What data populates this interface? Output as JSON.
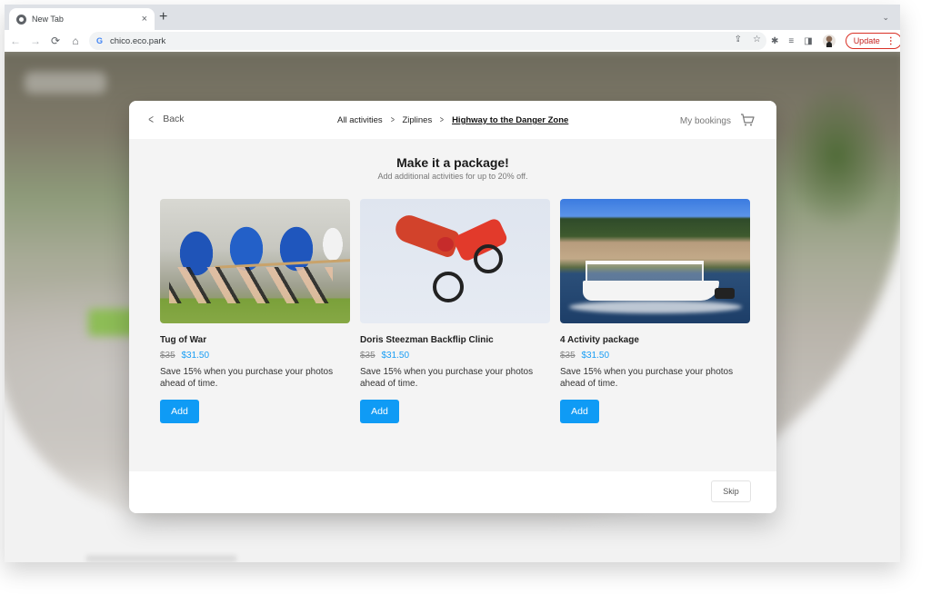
{
  "browser": {
    "tab_title": "New Tab",
    "tab_close": "×",
    "new_tab": "+",
    "tab_menu": "⌄",
    "url": "chico.eco.park",
    "update_label": "Update",
    "icons": {
      "back": "←",
      "forward": "→",
      "reload": "⟳",
      "home": "⌂",
      "share": "⇪",
      "bookmark": "☆",
      "extensions": "✱",
      "reading_list": "≡",
      "side_panel": "◨",
      "menu": "⋮"
    }
  },
  "modal": {
    "back_label": "Back",
    "breadcrumb": [
      {
        "label": "All activities"
      },
      {
        "label": "Ziplines"
      },
      {
        "label": "Highway to the Danger Zone"
      }
    ],
    "breadcrumb_separator": "›",
    "my_bookings": "My bookings",
    "title": "Make it a package!",
    "subtitle": "Add additional activities for up to 20% off.",
    "cards": [
      {
        "name": "Tug of War",
        "old_price": "$35",
        "new_price": "$31.50",
        "description": "Save 15% when you purchase your photos ahead of time.",
        "button": "Add",
        "image": "tug-of-war-photo"
      },
      {
        "name": "Doris Steezman Backflip Clinic",
        "old_price": "$35",
        "new_price": "$31.50",
        "description": "Save 15% when you purchase your photos ahead of time.",
        "button": "Add",
        "image": "motocross-backflip-photo"
      },
      {
        "name": "4 Activity package",
        "old_price": "$35",
        "new_price": "$31.50",
        "description": "Save 15% when you purchase your photos ahead of time.",
        "button": "Add",
        "image": "pontoon-boat-photo"
      }
    ],
    "skip_label": "Skip"
  },
  "colors": {
    "accent": "#0f9bf5",
    "sale_price": "#1a9ef5",
    "update_red": "#d93025"
  }
}
